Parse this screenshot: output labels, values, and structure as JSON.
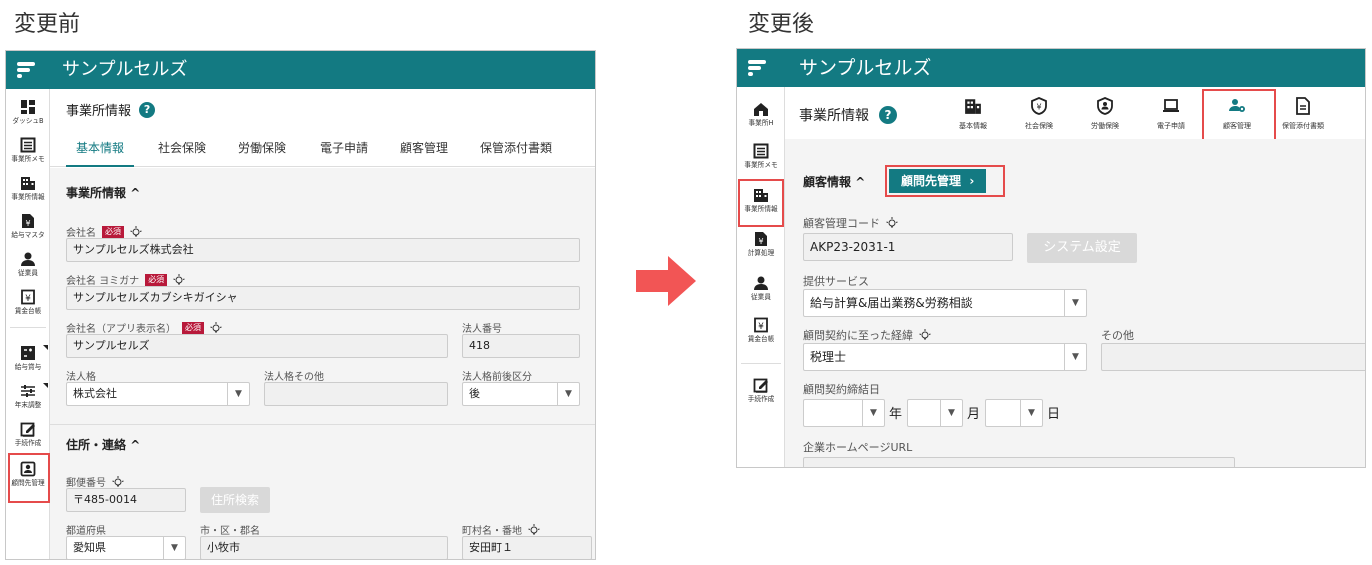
{
  "captions": {
    "before": "変更前",
    "after": "変更後"
  },
  "app": {
    "title": "サンプルセルズ"
  },
  "colors": {
    "brand": "#137a82",
    "highlight": "#e54b4b",
    "required": "#b8193a"
  },
  "before": {
    "sidebar": [
      {
        "label": "ダッシュB",
        "icon": "dashboard-icon"
      },
      {
        "label": "事業所メモ",
        "icon": "memo-icon"
      },
      {
        "label": "事業所情報",
        "icon": "building-icon"
      },
      {
        "label": "給与マスタ",
        "icon": "salary-file-icon"
      },
      {
        "label": "従業員",
        "icon": "person-icon"
      },
      {
        "label": "賃金台帳",
        "icon": "ledger-icon"
      },
      {
        "label": "給与賞与",
        "icon": "calculator-icon"
      },
      {
        "label": "年末調整",
        "icon": "sliders-icon"
      },
      {
        "label": "手続作成",
        "icon": "edit-icon"
      },
      {
        "label": "顧問先管理",
        "icon": "client-icon"
      }
    ],
    "office_title": "事業所情報",
    "tabs": [
      "基本情報",
      "社会保険",
      "労働保険",
      "電子申請",
      "顧客管理",
      "保管添付書類"
    ],
    "section_company": "事業所情報",
    "required_badge": "必須",
    "company_name_label": "会社名",
    "company_name": "サンプルセルズ株式会社",
    "company_kana_label": "会社名 ヨミガナ",
    "company_kana": "サンプルセルズカブシキガイシャ",
    "app_name_label": "会社名（アプリ表示名）",
    "app_name": "サンプルセルズ",
    "corp_number_label": "法人番号",
    "corp_number": "418",
    "corp_type_label": "法人格",
    "corp_type": "株式会社",
    "corp_other_label": "法人格その他",
    "corp_position_label": "法人格前後区分",
    "corp_position": "後",
    "section_address": "住所・連絡",
    "postal_label": "郵便番号",
    "postal": "〒485-0014",
    "address_search": "住所検索",
    "pref_label": "都道府県",
    "pref": "愛知県",
    "city_label": "市・区・郡名",
    "city": "小牧市",
    "town_label": "町村名・番地",
    "town": "安田町１"
  },
  "after": {
    "sidebar": [
      {
        "label": "事業所H",
        "icon": "home-icon"
      },
      {
        "label": "事業所メモ",
        "icon": "memo-icon"
      },
      {
        "label": "事業所情報",
        "icon": "building-icon"
      },
      {
        "label": "計算処理",
        "icon": "salary-file-icon"
      },
      {
        "label": "従業員",
        "icon": "person-icon"
      },
      {
        "label": "賃金台帳",
        "icon": "ledger-icon"
      },
      {
        "label": "手続作成",
        "icon": "edit-icon"
      }
    ],
    "office_title": "事業所情報",
    "top_tabs": [
      {
        "label": "基本情報",
        "icon": "building-icon"
      },
      {
        "label": "社会保険",
        "icon": "shield-yen-icon"
      },
      {
        "label": "労働保険",
        "icon": "worker-shield-icon"
      },
      {
        "label": "電子申請",
        "icon": "laptop-icon"
      },
      {
        "label": "顧客管理",
        "icon": "client-gear-icon"
      },
      {
        "label": "保管添付書類",
        "icon": "document-icon"
      }
    ],
    "section_customer": "顧客情報",
    "advisor_button": "顧問先管理",
    "customer_code_label": "顧客管理コード",
    "customer_code": "AKP23-2031-1",
    "system_settings": "システム設定",
    "services_label": "提供サービス",
    "services": "給与計算&届出業務&労務相談",
    "contract_reason_label": "顧問契約に至った経緯",
    "contract_reason": "税理士",
    "other_label": "その他",
    "contract_date_label": "顧問契約締結日",
    "year_unit": "年",
    "month_unit": "月",
    "day_unit": "日",
    "homepage_label": "企業ホームページURL"
  }
}
